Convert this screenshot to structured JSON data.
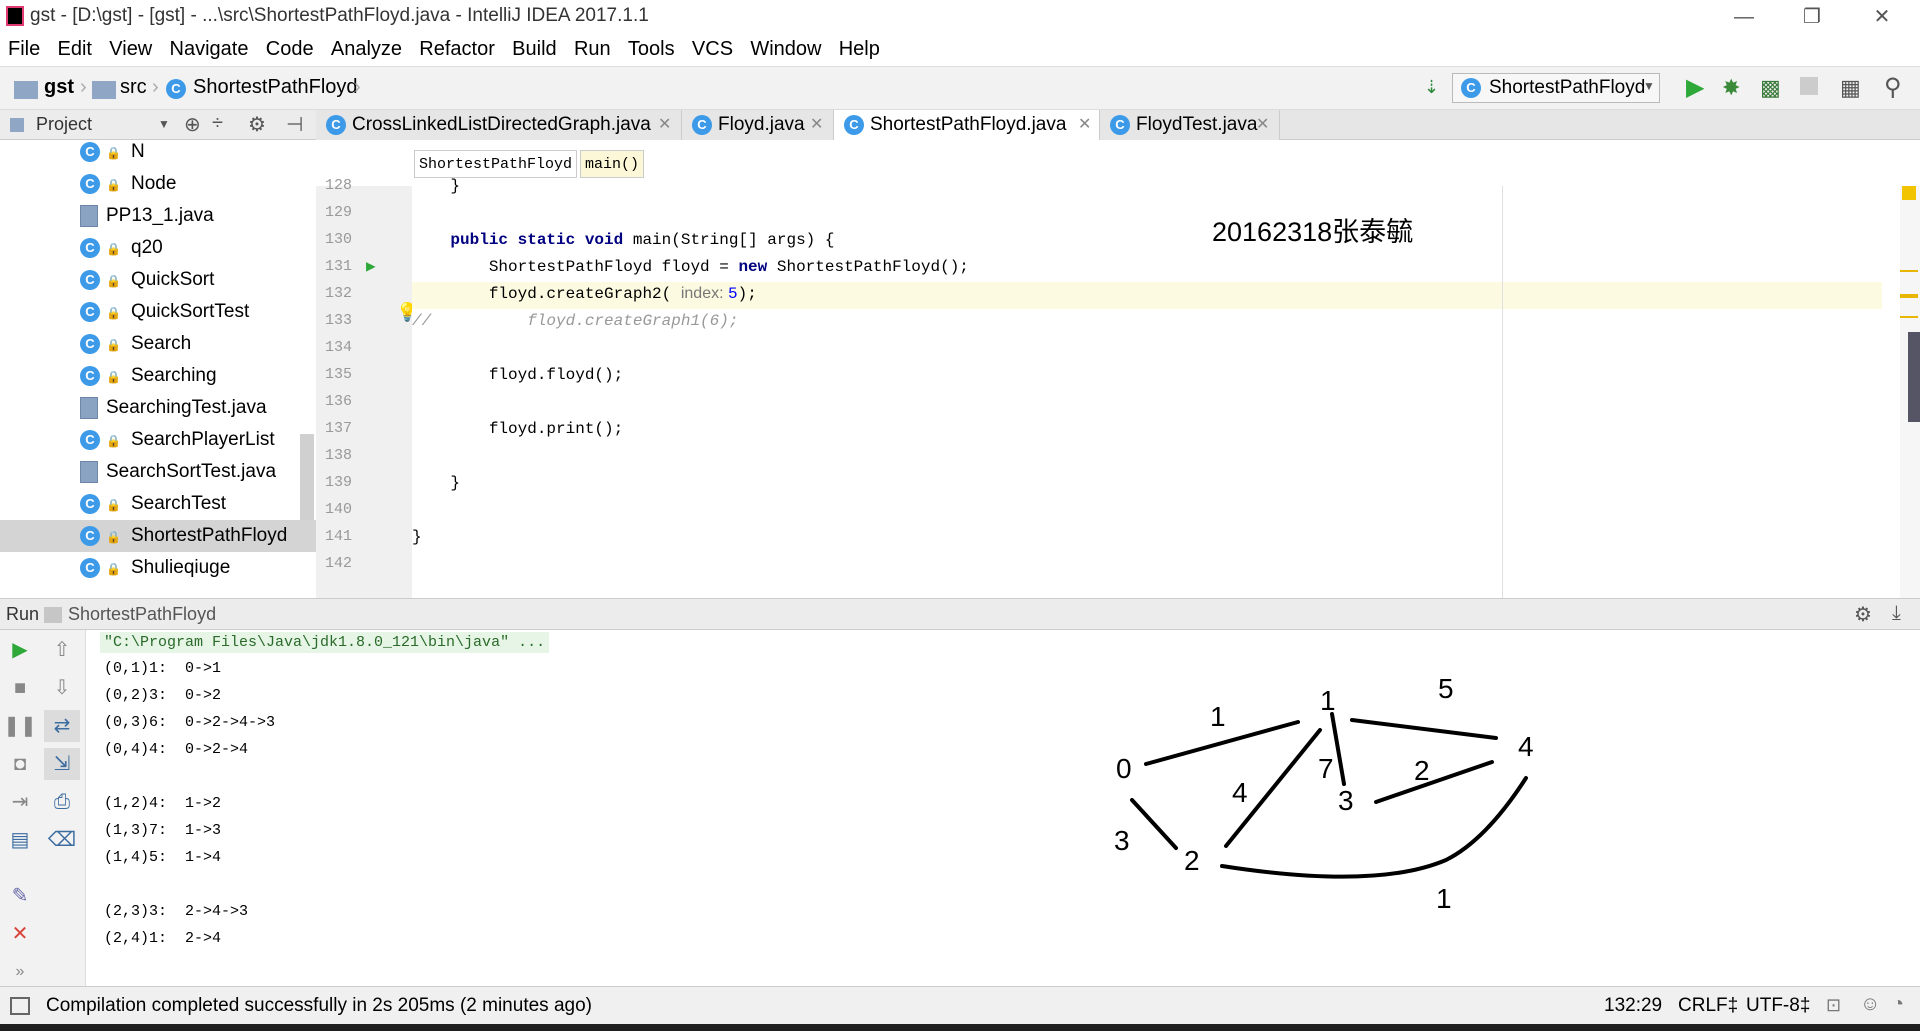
{
  "window": {
    "title": "gst - [D:\\gst] - [gst] - ...\\src\\ShortestPathFloyd.java - IntelliJ IDEA 2017.1.1",
    "minimize": "—",
    "maximize": "❐",
    "close": "✕"
  },
  "menu": [
    "File",
    "Edit",
    "View",
    "Navigate",
    "Code",
    "Analyze",
    "Refactor",
    "Build",
    "Run",
    "Tools",
    "VCS",
    "Window",
    "Help"
  ],
  "nav": {
    "crumbs": [
      "gst",
      "src",
      "ShortestPathFloyd"
    ],
    "run_config": "ShortestPathFloyd"
  },
  "project": {
    "title": "Project",
    "items": [
      {
        "label": "N",
        "kind": "class"
      },
      {
        "label": "Node",
        "kind": "class"
      },
      {
        "label": "PP13_1.java",
        "kind": "file"
      },
      {
        "label": "q20",
        "kind": "class"
      },
      {
        "label": "QuickSort",
        "kind": "class"
      },
      {
        "label": "QuickSortTest",
        "kind": "class"
      },
      {
        "label": "Search",
        "kind": "class"
      },
      {
        "label": "Searching",
        "kind": "class"
      },
      {
        "label": "SearchingTest.java",
        "kind": "file"
      },
      {
        "label": "SearchPlayerList",
        "kind": "class"
      },
      {
        "label": "SearchSortTest.java",
        "kind": "file"
      },
      {
        "label": "SearchTest",
        "kind": "class"
      },
      {
        "label": "ShortestPathFloyd",
        "kind": "class",
        "selected": true
      },
      {
        "label": "Shulieqiuge",
        "kind": "class"
      }
    ]
  },
  "tabs": [
    {
      "label": "CrossLinkedListDirectedGraph.java",
      "active": false
    },
    {
      "label": "Floyd.java",
      "active": false
    },
    {
      "label": "ShortestPathFloyd.java",
      "active": true
    },
    {
      "label": "FloydTest.java",
      "active": false
    }
  ],
  "editor": {
    "crumb_class": "ShortestPathFloyd",
    "crumb_method": "main()",
    "watermark": "20162318张泰毓",
    "lines": [
      {
        "n": "128",
        "code": "    }"
      },
      {
        "n": "129",
        "code": ""
      },
      {
        "n": "130",
        "kw": "public static void ",
        "code": "main(String[] args) {"
      },
      {
        "n": "131",
        "code": "        ShortestPathFloyd floyd = ",
        "kw2": "new ",
        "code2": "ShortestPathFloyd();"
      },
      {
        "n": "132",
        "code": "        floyd.createGraph2( ",
        "hint": "index: ",
        "num": "5",
        "code2": ");",
        "current": true
      },
      {
        "n": "133",
        "cmt": "//          floyd.createGraph1(6);"
      },
      {
        "n": "134",
        "code": ""
      },
      {
        "n": "135",
        "code": "        floyd.floyd();"
      },
      {
        "n": "136",
        "code": ""
      },
      {
        "n": "137",
        "code": "        floyd.print();"
      },
      {
        "n": "138",
        "code": ""
      },
      {
        "n": "139",
        "code": "    }"
      },
      {
        "n": "140",
        "code": ""
      },
      {
        "n": "141",
        "code": "}"
      },
      {
        "n": "142",
        "code": ""
      }
    ]
  },
  "run": {
    "label": "Run",
    "config": "ShortestPathFloyd",
    "command": "\"C:\\Program Files\\Java\\jdk1.8.0_121\\bin\\java\" ...",
    "output": [
      "(0,1)1:  0->1",
      "(0,2)3:  0->2",
      "(0,3)6:  0->2->4->3",
      "(0,4)4:  0->2->4",
      "",
      "(1,2)4:  1->2",
      "(1,3)7:  1->3",
      "(1,4)5:  1->4",
      "",
      "(2,3)3:  2->4->3",
      "(2,4)1:  2->4"
    ],
    "graph": {
      "nodes": [
        "0",
        "1",
        "2",
        "3",
        "4"
      ],
      "weights": [
        "1",
        "5",
        "4",
        "7",
        "2",
        "3",
        "1"
      ]
    }
  },
  "status": {
    "message": "Compilation completed successfully in 2s 205ms (2 minutes ago)",
    "position": "132:29",
    "line_sep": "CRLF‡",
    "encoding": "UTF-8‡"
  }
}
